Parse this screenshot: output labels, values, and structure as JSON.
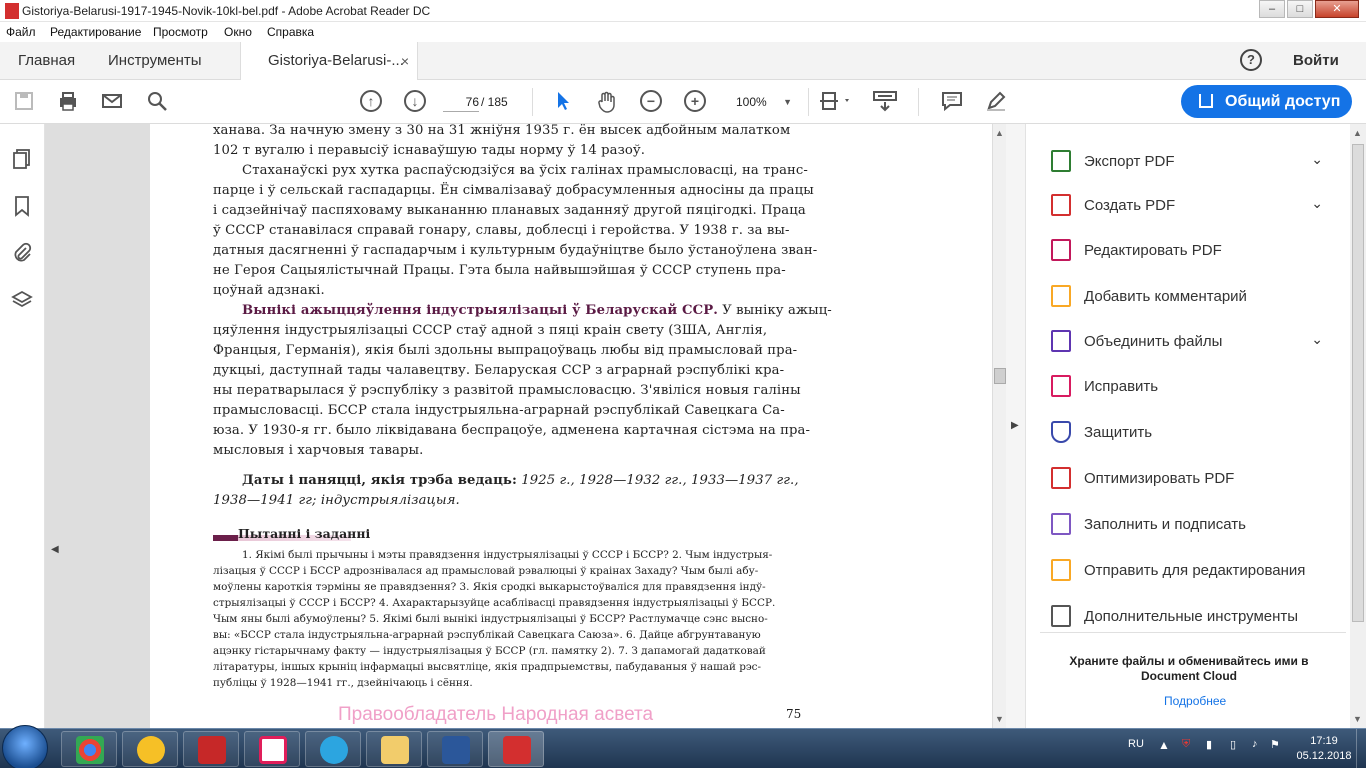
{
  "window": {
    "title": "Gistoriya-Belarusi-1917-1945-Novik-10kl-bel.pdf - Adobe Acrobat Reader DC"
  },
  "menu": [
    "Файл",
    "Редактирование",
    "Просмотр",
    "Окно",
    "Справка"
  ],
  "tabs": {
    "home": "Главная",
    "tools": "Инструменты",
    "doc": "Gistoriya-Belarusi-...",
    "close": "×"
  },
  "header": {
    "help": "?",
    "login": "Войти"
  },
  "toolbar": {
    "page_current": "76",
    "page_total": "/ 185",
    "zoom": "100%",
    "share": "Общий доступ"
  },
  "doc": {
    "lines": [
      "ханава. За начную змену з 30 на 31 жніўня 1935 г. ён высек адбойным малатком",
      "102 т вугалю і перавысіў існаваўшую тады норму ў 14 разоў.",
      "Стаханаўскі рух хутка распаўсюдзіўся ва ўсіх галінах прамысловасці, на транс-",
      "парце і ў сельскай гаспадарцы. Ён сімвалізаваў добрасумленныя адносіны да працы",
      "і садзейнічаў паспяховаму выкананню планавых заданняў другой пяцігодкі. Праца",
      "ў СССР станавілася справай гонару, славы, доблесці і геройства. У 1938 г. за вы-",
      "датныя дасягненні ў гаспадарчым і культурным будаўніцтве было ўстаноўлена зван-",
      "не Героя Сацыялістычнай Працы. Гэта была найвышэйшая ў СССР ступень пра-",
      "цоўнай адзнакі."
    ],
    "p2_head": "Вынікі ажыццяўлення індустрыялізацыі ў Беларускай ССР.",
    "p2_first_rest": " У выніку ажыц-",
    "p2_lines": [
      "цяўлення індустрыялізацыі СССР стаў адной з пяці краін свету (ЗША, Англія,",
      "Францыя, Германія), якія былі здольны выпрацоўваць любы від прамысловай пра-",
      "дукцыі, даступнай тады чалавецтву. Беларуская ССР з аграрнай рэспублікі кра-",
      "ны ператварылася ў рэспубліку з развітой прамысловасцю. З'явіліся новыя галіны",
      "прамысловасці. БССР стала індустрыяльна-аграрнай рэспублікай Савецкага Са-",
      "юза. У 1930-я гг. было ліквідавана беспрацоўе, адменена картачная сістэма на пра-",
      "мысловыя і харчовыя тавары."
    ],
    "dates_head": "Даты і паняцці, якія трэба ведаць:",
    "dates_rest": " 1925 г., 1928—1932 гг., 1933—1937 гг.,",
    "dates_line2": "1938—1941 гг; індустрыялізацыя.",
    "section_title": "Пытанні і заданні",
    "questions": [
      "1. Якімі былі прычыны і мэты правядзення індустрыялізацыі ў СССР і БССР? 2. Чым індустрыя-",
      "лізацыя ў СССР і БССР адрознівалася ад прамысловай рэвалюцыі ў краінах Захаду? Чым былі абу-",
      "моўлены кароткія тэрміны яе правядзення? 3. Якія сродкі выкарыстоўваліся для правядзення індў-",
      "стрыялізацыі ў СССР і БССР? 4. Ахарактарызуйце асаблівасці правядзення індустрыялізацыі ў БССР.",
      "Чым яны былі абумоўлены? 5. Якімі былі вынікі індустрыялізацыі ў БССР? Растлумачце сэнс высно-",
      "вы: «БССР стала індустрыяльна-аграрнай рэспублікай Савецкага Саюза». 6. Дайце абгрунтаваную",
      "ацэнку гістарычнаму факту — індустрыялізацыя ў БССР (гл. памятку 2). 7. З дапамогай дадатковай",
      "літаратуры, іншых крыніц інфармацыі высвятліце, якія прадпрыемствы, пабудаваныя ў нашай рэс-",
      "публіцы ў 1928—1941 гг., дзейнічаюць і сёння."
    ],
    "watermark": "Правообладатель Народная асвета",
    "page_number": "75"
  },
  "tools_panel": {
    "items": [
      {
        "label": "Экспорт PDF",
        "color": "#2e7d32",
        "icon": "export-pdf-icon",
        "chevron": true
      },
      {
        "label": "Создать PDF",
        "color": "#d32f2f",
        "icon": "create-pdf-icon",
        "chevron": true
      },
      {
        "label": "Редактировать PDF",
        "color": "#c2185b",
        "icon": "edit-pdf-icon",
        "chevron": false
      },
      {
        "label": "Добавить комментарий",
        "color": "#f9a825",
        "icon": "comment-icon",
        "chevron": false
      },
      {
        "label": "Объединить файлы",
        "color": "#5e35b1",
        "icon": "combine-files-icon",
        "chevron": true
      },
      {
        "label": "Исправить",
        "color": "#d81b60",
        "icon": "fix-icon",
        "chevron": false
      },
      {
        "label": "Защитить",
        "color": "#3949ab",
        "icon": "protect-icon",
        "chevron": false
      },
      {
        "label": "Оптимизировать PDF",
        "color": "#d32f2f",
        "icon": "optimize-pdf-icon",
        "chevron": false
      },
      {
        "label": "Заполнить и подписать",
        "color": "#7e57c2",
        "icon": "fill-sign-icon",
        "chevron": false
      },
      {
        "label": "Отправить для редактирования",
        "color": "#f9a825",
        "icon": "send-review-icon",
        "chevron": false
      },
      {
        "label": "Дополнительные инструменты",
        "color": "#555555",
        "icon": "more-tools-icon",
        "chevron": false
      }
    ],
    "promo": "Храните файлы и обменивайтесь ими в Document Cloud",
    "more": "Подробнее"
  },
  "taskbar": {
    "lang": "RU",
    "time": "17:19",
    "date": "05.12.2018"
  }
}
